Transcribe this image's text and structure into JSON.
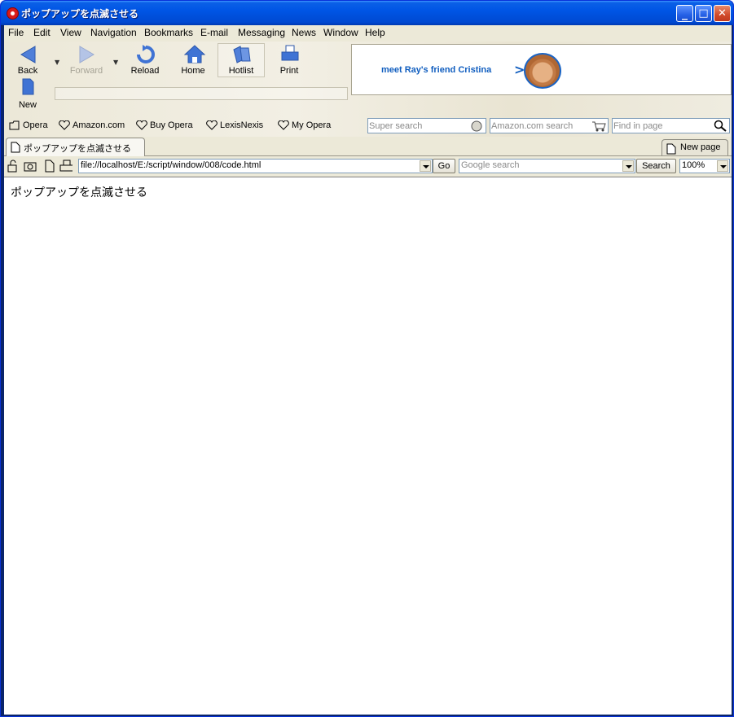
{
  "window": {
    "title": "ポップアップを点滅させる",
    "controls": {
      "minimize": "_",
      "maximize": "□",
      "close": "✕"
    }
  },
  "menu": [
    "File",
    "Edit",
    "View",
    "Navigation",
    "Bookmarks",
    "E-mail",
    "Messaging",
    "News",
    "Window",
    "Help"
  ],
  "toolbar": {
    "back": "Back",
    "forward": "Forward",
    "reload": "Reload",
    "home": "Home",
    "hotlist": "Hotlist",
    "print": "Print",
    "new": "New"
  },
  "banner": {
    "text": "meet Ray's friend Cristina",
    "arrow": ">"
  },
  "personal_bar": {
    "items": [
      "Opera",
      "Amazon.com",
      "Buy Opera",
      "LexisNexis",
      "My Opera"
    ],
    "super_search_placeholder": "Super search",
    "amazon_search_placeholder": "Amazon.com search",
    "find_placeholder": "Find in page"
  },
  "tabs": {
    "active": "ポップアップを点滅させる",
    "new_page": "New page"
  },
  "address": {
    "url": "file://localhost/E:/script/window/008/code.html",
    "go": "Go",
    "google_placeholder": "Google search",
    "search": "Search",
    "zoom": "100%"
  },
  "page": {
    "text": "ポップアップを点滅させる"
  },
  "colors": {
    "titlebar": "#0055e5",
    "chrome": "#ece9d8",
    "banner_text": "#0f5dbf"
  }
}
